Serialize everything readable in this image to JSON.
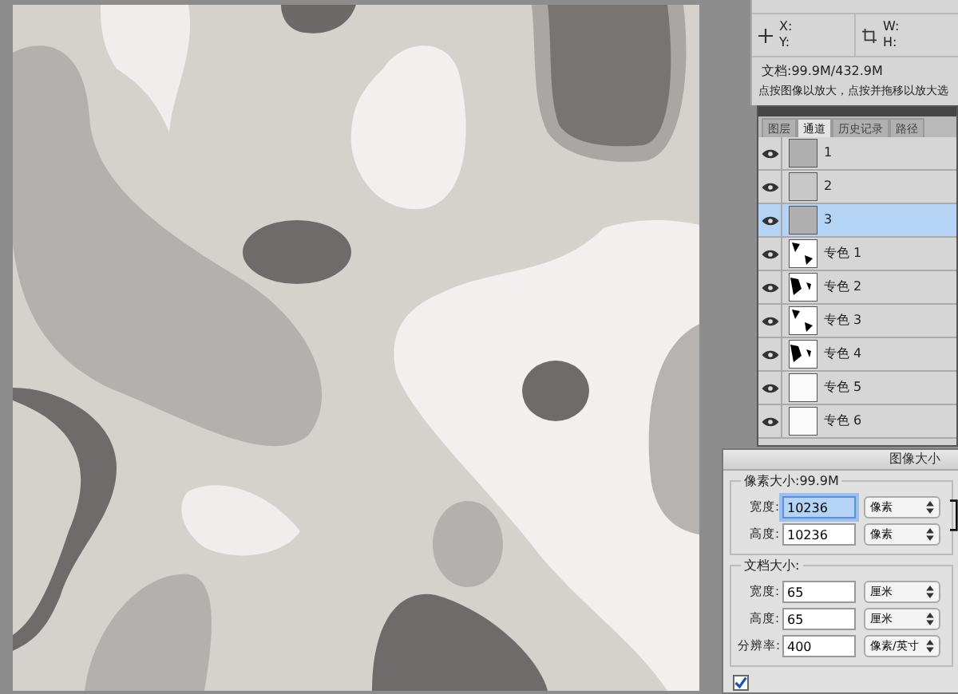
{
  "info_panel": {
    "x_label": "X:",
    "y_label": "Y:",
    "w_label": "W:",
    "h_label": "H:",
    "document": "文档:99.9M/432.9M",
    "hint": "点按图像以放大，点按并拖移以放大选"
  },
  "channels_panel": {
    "tabs": [
      {
        "label": "图层",
        "selected": false
      },
      {
        "label": "通道",
        "selected": true
      },
      {
        "label": "历史记录",
        "selected": false
      },
      {
        "label": "路径",
        "selected": false
      }
    ],
    "channels": [
      {
        "name": "1",
        "kind": "gray",
        "visible": true,
        "selected": false
      },
      {
        "name": "2",
        "kind": "gray",
        "visible": true,
        "selected": false
      },
      {
        "name": "3",
        "kind": "gray",
        "visible": true,
        "selected": true
      },
      {
        "name": "专色 1",
        "kind": "spot",
        "visible": true,
        "selected": false
      },
      {
        "name": "专色 2",
        "kind": "spot",
        "visible": true,
        "selected": false
      },
      {
        "name": "专色 3",
        "kind": "spot",
        "visible": true,
        "selected": false
      },
      {
        "name": "专色 4",
        "kind": "spot",
        "visible": true,
        "selected": false
      },
      {
        "name": "专色 5",
        "kind": "blank",
        "visible": true,
        "selected": false
      },
      {
        "name": "专色 6",
        "kind": "blank",
        "visible": true,
        "selected": false
      }
    ]
  },
  "image_size_dialog": {
    "title": "图像大小",
    "pixel_group": {
      "title": "像素大小:99.9M",
      "fields": [
        {
          "label": "宽度:",
          "value": "10236",
          "unit": "像素",
          "focused": true
        },
        {
          "label": "高度:",
          "value": "10236",
          "unit": "像素",
          "focused": false
        }
      ]
    },
    "document_group": {
      "title": "文档大小:",
      "fields": [
        {
          "label": "宽度:",
          "value": "65",
          "unit": "厘米",
          "focused": false
        },
        {
          "label": "高度:",
          "value": "65",
          "unit": "厘米",
          "focused": false
        },
        {
          "label": "分辨率:",
          "value": "400",
          "unit": "像素/英寸",
          "focused": false
        }
      ]
    },
    "scale_styles": {
      "checked": true
    }
  }
}
